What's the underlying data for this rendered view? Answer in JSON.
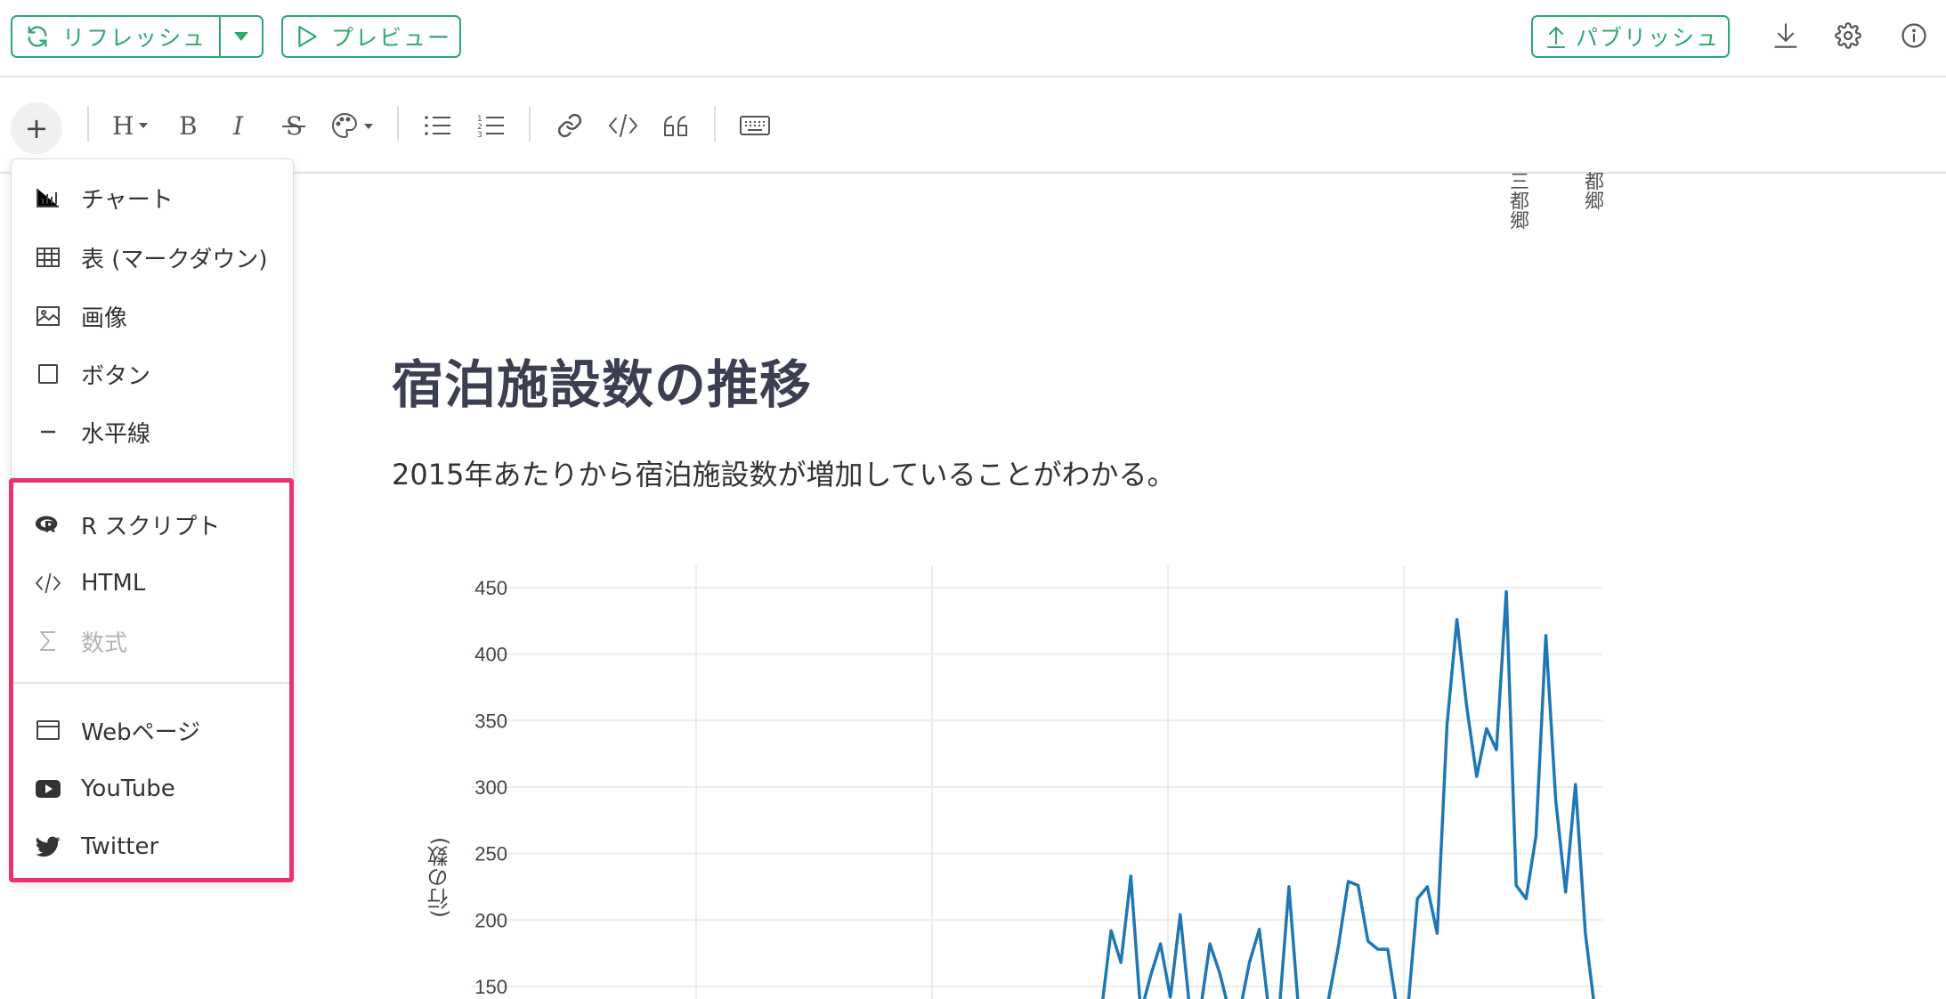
{
  "topbar": {
    "refresh_label": "リフレッシュ",
    "preview_label": "プレビュー",
    "publish_label": "パブリッシュ",
    "icons": [
      "download-icon",
      "gear-icon",
      "info-icon"
    ]
  },
  "toolbar": {
    "icons": [
      "heading-icon",
      "bold-icon",
      "italic-icon",
      "strikethrough-icon",
      "palette-icon",
      "bullet-list-icon",
      "numbered-list-icon",
      "link-icon",
      "code-icon",
      "quote-icon",
      "keyboard-icon"
    ]
  },
  "menu": {
    "items": [
      {
        "label": "チャート",
        "icon": "bar-chart-icon"
      },
      {
        "label": "表 (マークダウン)",
        "icon": "table-icon"
      },
      {
        "label": "画像",
        "icon": "image-icon"
      },
      {
        "label": "ボタン",
        "icon": "square-icon"
      },
      {
        "label": "水平線",
        "icon": "horizontal-line-icon"
      },
      {
        "label": "R スクリプト",
        "icon": "r-logo-icon"
      },
      {
        "label": "HTML",
        "icon": "code-icon"
      },
      {
        "label": "数式",
        "icon": "sigma-icon",
        "disabled": true
      },
      {
        "label": "Webページ",
        "icon": "browser-window-icon"
      },
      {
        "label": "YouTube",
        "icon": "youtube-icon"
      },
      {
        "label": "Twitter",
        "icon": "twitter-icon"
      }
    ],
    "highlight_color": "#e8336b"
  },
  "doc": {
    "rotated_labels": [
      "三都郷",
      "都郷"
    ],
    "title": "宿泊施設数の推移",
    "paragraph": "2015年あたりから宿泊施設数が増加していることがわかる。"
  },
  "chart_data": {
    "type": "line",
    "ylabel": "(行の数)",
    "ylim": [
      130,
      470
    ],
    "yticks": [
      150,
      200,
      250,
      300,
      350,
      400,
      450
    ],
    "grid": true,
    "line_color": "#1f77b4",
    "series": [
      {
        "values": [
          130,
          192,
          168,
          233,
          130,
          158,
          182,
          142,
          204,
          130,
          130,
          182,
          160,
          130,
          130,
          168,
          193,
          130,
          130,
          225,
          130,
          130,
          130,
          140,
          180,
          229,
          226,
          184,
          178,
          178,
          130,
          130,
          216,
          225,
          190,
          347,
          426,
          360,
          308,
          344,
          328,
          447,
          226,
          216,
          263,
          414,
          290,
          221,
          302,
          190,
          130
        ]
      }
    ]
  }
}
